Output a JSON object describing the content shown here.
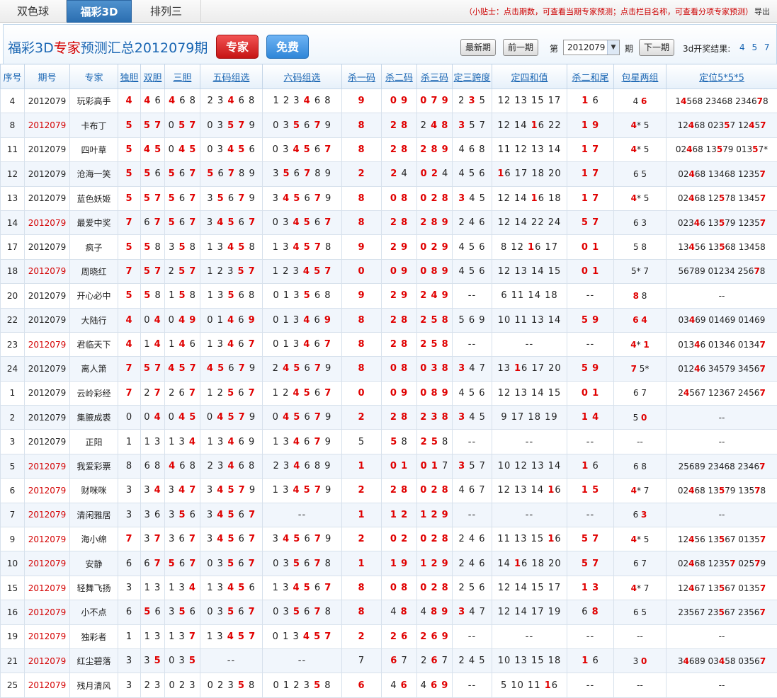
{
  "tabs": [
    {
      "label": "双色球",
      "active": false
    },
    {
      "label": "福彩3D",
      "active": true
    },
    {
      "label": "排列三",
      "active": false
    }
  ],
  "tip": {
    "text": "（小贴士：点击期数，可查看当期专家预测；点击栏目名称，可查看分项专家预测）",
    "export": "导出"
  },
  "header": {
    "title_prefix": "福彩3D",
    "title_highlight": "专家",
    "title_suffix": "预测汇总2012079期",
    "expert_button": "专家",
    "free_button": "免费",
    "latest_button": "最新期",
    "prev_button": "前一期",
    "label_di": "第",
    "selected_issue": "2012079",
    "label_qi": "期",
    "next_button": "下一期",
    "result_label": "3d开奖结果:",
    "result_value": "4 5 7"
  },
  "columns": [
    "序号",
    "期号",
    "专家",
    "独胆",
    "双胆",
    "三胆",
    "五码组选",
    "六码组选",
    "杀一码",
    "杀二码",
    "杀三码",
    "定三跨度",
    "定四和值",
    "杀二和尾",
    "包星两组",
    "定位5*5*5"
  ],
  "colors": {
    "accent": "#1a66b3",
    "hit": "#e00000",
    "row_alt": "#f1f6fc"
  },
  "rows": [
    {
      "id": "4",
      "issue": "2012079",
      "issue_red": false,
      "expert": "玩彩高手",
      "c": [
        "*4",
        "*4 6",
        "*4 6 8",
        "2 3 *4 6 8",
        "1 2 3 *4 6 8",
        "*9",
        "*0 *9",
        "*0 *7 *9",
        "2 *3 5",
        "12 13 15 17",
        "*1 6",
        "**4 *6*",
        "1*4568 23468 2346*7*8"
      ]
    },
    {
      "id": "8",
      "issue": "2012079",
      "issue_red": true,
      "expert": "卡布丁",
      "c": [
        "*5",
        "*5 *7",
        "0 *5 *7",
        "0 3 *5 *7 9",
        "0 3 *5 6 *7 9",
        "*8",
        "*2 *8",
        "2 *4 *8",
        "*3 5 7",
        "12 14 *16 22",
        "*1 *9",
        "*4** **5",
        "12*4*68 023*5*7 12*4*5*7*"
      ]
    },
    {
      "id": "11",
      "issue": "2012079",
      "issue_red": false,
      "expert": "四叶草",
      "c": [
        "*5",
        "*4 *5",
        "0 *4 *5",
        "0 3 *4 *5 6",
        "0 3 *4 *5 6 *7",
        "*8",
        "*2 *8",
        "*2 *8 *9",
        "4 6 8",
        "11 12 13 14",
        "*1 *7",
        "*4** **5",
        "02*4*68 13*5*79 013*5*7*"
      ]
    },
    {
      "id": "12",
      "issue": "2012079",
      "issue_red": false,
      "expert": "沧海一笑",
      "c": [
        "*5",
        "*5 6",
        "*5 6 *7",
        "*5 6 *7 8 9",
        "3 *5 6 *7 8 9",
        "*2",
        "*2 4",
        "*0 *2 4",
        "4 5 6",
        "*16 17 18 20",
        "*1 *7",
        "6** **5",
        "02*4*68 13468 1235*7*"
      ]
    },
    {
      "id": "13",
      "issue": "2012079",
      "issue_red": false,
      "expert": "蓝色妖姬",
      "c": [
        "*5",
        "*5 *7",
        "*5 6 *7",
        "3 *5 6 *7 9",
        "3 *4 *5 6 *7 9",
        "*8",
        "*0 *8",
        "*0 *2 *8",
        "*3 4 5",
        "12 14 *16 18",
        "*1 *7",
        "*4** **5",
        "02*4*68 12*5*78 1345*7*"
      ]
    },
    {
      "id": "14",
      "issue": "2012079",
      "issue_red": true,
      "expert": "最爱中奖",
      "c": [
        "*7",
        "6 *7",
        "*5 6 *7",
        "3 *4 *5 6 *7",
        "0 3 *4 *5 6 *7",
        "*8",
        "*2 *8",
        "*2 *8 *9",
        "2 4 6",
        "12 14 22 24",
        "*5 *7",
        "6** **3",
        "023*4*6 13*5*79 1235*7*"
      ]
    },
    {
      "id": "17",
      "issue": "2012079",
      "issue_red": false,
      "expert": "疯子",
      "c": [
        "*5",
        "*5 8",
        "3 *5 8",
        "1 3 *4 *5 8",
        "1 3 *4 *5 *7 8",
        "*9",
        "*2 *9",
        "*0 *2 *9",
        "4 5 6",
        "8 12 *16 17",
        "*0 *1",
        "5** **8",
        "13*4*56 13*5*68 13458"
      ]
    },
    {
      "id": "18",
      "issue": "2012079",
      "issue_red": true,
      "expert": "周晓红",
      "c": [
        "*7",
        "*5 *7",
        "2 *5 *7",
        "1 2 3 *5 *7",
        "1 2 3 *4 *5 *7",
        "*0",
        "*0 *9",
        "*0 *8 *9",
        "4 5 6",
        "12 13 14 15",
        "*0 *1",
        "**5* **7",
        "56789 01234 256*7*8"
      ]
    },
    {
      "id": "20",
      "issue": "2012079",
      "issue_red": false,
      "expert": "开心必中",
      "c": [
        "*5",
        "*5 8",
        "1 *5 8",
        "1 3 *5 6 8",
        "0 1 3 *5 6 8",
        "*9",
        "*2 *9",
        "*2 *4 *9",
        "--",
        "6 11 14 18",
        "--",
        "*8* 8**",
        "--"
      ]
    },
    {
      "id": "22",
      "issue": "2012079",
      "issue_red": false,
      "expert": "大陆行",
      "c": [
        "*4",
        "0 *4",
        "0 *4 *9",
        "0 1 *4 6 *9",
        "0 1 3 *4 6 *9",
        "*8",
        "*2 *8",
        "*2 *5 *8",
        "5 6 9",
        "10 11 13 14",
        "*5 *9",
        "*6* *4*",
        "03*4*69 01469 01469"
      ]
    },
    {
      "id": "23",
      "issue": "2012079",
      "issue_red": true,
      "expert": "君临天下",
      "c": [
        "*4",
        "1 *4",
        "1 *4 6",
        "1 3 *4 6 *7",
        "0 1 3 *4 6 *7",
        "*8",
        "*2 *8",
        "*2 *5 *8",
        "--",
        "--",
        "--",
        "*4** *1*",
        "013*4*6 01346 0134*7*"
      ]
    },
    {
      "id": "24",
      "issue": "2012079",
      "issue_red": false,
      "expert": "离人箫",
      "c": [
        "*7",
        "*5 *7",
        "*4 *5 *7",
        "*4 *5 6 *7 9",
        "2 *4 *5 6 *7 9",
        "*8",
        "*0 *8",
        "*0 *3 *8",
        "*3 4 7",
        "13 *16 17 20",
        "*5 *9",
        "*7* **5*",
        "012*4*6 34579 3456*7*"
      ]
    },
    {
      "id": "1",
      "issue": "2012079",
      "issue_red": false,
      "expert": "云岭彩经",
      "c": [
        "*7",
        "2 *7",
        "2 6 *7",
        "1 2 *5 6 *7",
        "1 2 *4 *5 6 *7",
        "*0",
        "*0 *9",
        "*0 *8 *9",
        "4 5 6",
        "12 13 14 15",
        "*0 *1",
        "6** 7**",
        "2*4*567 12367 2456*7*"
      ]
    },
    {
      "id": "2",
      "issue": "2012079",
      "issue_red": false,
      "expert": "集腋成裘",
      "c": [
        "0",
        "0 *4",
        "0 *4 *5",
        "0 *4 *5 *7 9",
        "0 *4 *5 6 *7 9",
        "*2",
        "*2 *8",
        "*2 *3 *8",
        "*3 4 5",
        "9 17 18 19",
        "*1 *4",
        "5** *0*",
        "--"
      ]
    },
    {
      "id": "3",
      "issue": "2012079",
      "issue_red": false,
      "expert": "正阳",
      "c": [
        "1",
        "1 3",
        "1 3 *4",
        "1 3 *4 6 9",
        "1 3 *4 6 *7 9",
        "5",
        "*5 8",
        "*2 *5 8",
        "--",
        "--",
        "--",
        "--",
        "--"
      ]
    },
    {
      "id": "5",
      "issue": "2012079",
      "issue_red": true,
      "expert": "我爱彩票",
      "c": [
        "8",
        "6 8",
        "*4 6 8",
        "2 3 *4 6 8",
        "2 3 *4 6 8 9",
        "*1",
        "*0 *1",
        "*0 *1 7",
        "*3 5 7",
        "10 12 13 14",
        "*1 6",
        "**6 8**",
        "25689 23468 2346*7*"
      ]
    },
    {
      "id": "6",
      "issue": "2012079",
      "issue_red": true,
      "expert": "财咪咪",
      "c": [
        "3",
        "3 *4",
        "3 *4 *7",
        "3 *4 *5 *7 9",
        "1 3 *4 *5 *7 9",
        "*2",
        "*2 *8",
        "*0 *2 *8",
        "4 6 7",
        "12 13 14 *16",
        "*1 *5",
        "*4** **7",
        "02*4*68 13*5*79 135*7*8"
      ]
    },
    {
      "id": "7",
      "issue": "2012079",
      "issue_red": true,
      "expert": "清闲雅居",
      "c": [
        "3",
        "3 6",
        "3 *5 6",
        "3 *4 *5 6 *7",
        "--",
        "*1",
        "*1 *2",
        "*1 *2 *9",
        "--",
        "--",
        "--",
        "6** *3*",
        "--"
      ]
    },
    {
      "id": "9",
      "issue": "2012079",
      "issue_red": true,
      "expert": "海小绵",
      "c": [
        "*7",
        "3 *7",
        "3 6 *7",
        "3 *4 *5 6 *7",
        "3 *4 *5 6 *7 9",
        "*2",
        "*0 *2",
        "*0 *2 *8",
        "2 4 6",
        "11 13 15 *16",
        "*5 *7",
        "*4** **5",
        "12*4*56 13*5*67 0135*7*"
      ]
    },
    {
      "id": "10",
      "issue": "2012079",
      "issue_red": true,
      "expert": "安静",
      "c": [
        "6",
        "6 *7",
        "*5 6 *7",
        "0 3 *5 6 *7",
        "0 3 *5 6 *7 8",
        "*1",
        "*1 *9",
        "*1 *2 *9",
        "2 4 6",
        "14 *16 18 20",
        "*5 *7",
        "6** **7",
        "02*4*68 1235*7* 025*7*9"
      ]
    },
    {
      "id": "15",
      "issue": "2012079",
      "issue_red": true,
      "expert": "轻舞飞扬",
      "c": [
        "3",
        "1 3",
        "1 3 *4",
        "1 3 *4 *5 6",
        "1 3 *4 *5 6 *7",
        "*8",
        "*0 *8",
        "*0 *2 *8",
        "2 5 6",
        "12 14 15 17",
        "*1 *3",
        "*4** **7",
        "12*4*67 13*5*67 0135*7*"
      ]
    },
    {
      "id": "16",
      "issue": "2012079",
      "issue_red": true,
      "expert": "小不点",
      "c": [
        "6",
        "*5 6",
        "3 *5 6",
        "0 3 *5 6 *7",
        "0 3 *5 6 *7 8",
        "*8",
        "4 *8",
        "4 *8 *9",
        "*3 4 7",
        "12 14 17 19",
        "6 *8",
        "6** **5",
        "23567 23*5*67 2356*7*"
      ]
    },
    {
      "id": "19",
      "issue": "2012079",
      "issue_red": true,
      "expert": "独彩者",
      "c": [
        "1",
        "1 3",
        "1 3 *7",
        "1 3 *4 *5 *7",
        "0 1 3 *4 *5 *7",
        "*2",
        "*2 *6",
        "*2 *6 *9",
        "--",
        "--",
        "--",
        "--",
        "--"
      ]
    },
    {
      "id": "21",
      "issue": "2012079",
      "issue_red": true,
      "expert": "红尘碧落",
      "c": [
        "3",
        "3 *5",
        "0 3 *5",
        "--",
        "--",
        "7",
        "*6 7",
        "2 *6 7",
        "2 4 5",
        "10 13 15 18",
        "*1 6",
        "3** *0*",
        "3*4*689 03*4*58 0356*7*"
      ]
    },
    {
      "id": "25",
      "issue": "2012079",
      "issue_red": true,
      "expert": "残月清风",
      "c": [
        "3",
        "2 3",
        "0 2 3",
        "0 2 3 *5 8",
        "0 1 2 3 *5 8",
        "*6",
        "4 *6",
        "4 *6 *9",
        "--",
        "5 10 11 *16",
        "--",
        "--",
        "--"
      ]
    }
  ]
}
